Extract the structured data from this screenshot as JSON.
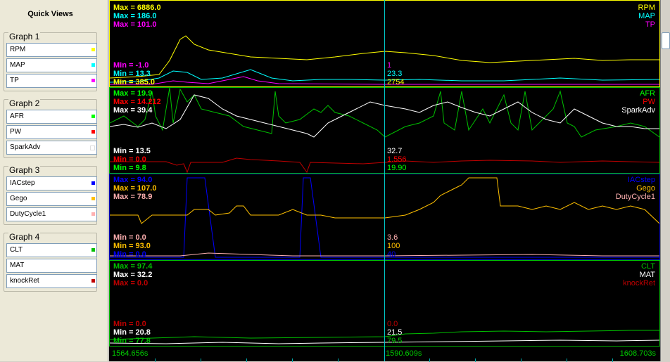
{
  "sidebar": {
    "title": "Quick Views",
    "groups": [
      {
        "title": "Graph 1",
        "items": [
          {
            "label": "RPM",
            "color": "#ffff00"
          },
          {
            "label": "MAP",
            "color": "#00ffff"
          },
          {
            "label": "TP",
            "color": "#ff00ff"
          }
        ]
      },
      {
        "title": "Graph 2",
        "items": [
          {
            "label": "AFR",
            "color": "#00ff00"
          },
          {
            "label": "PW",
            "color": "#ff0000"
          },
          {
            "label": "SparkAdv",
            "color": "#ffffff"
          }
        ]
      },
      {
        "title": "Graph 3",
        "items": [
          {
            "label": "IACstep",
            "color": "#0000ff"
          },
          {
            "label": "Gego",
            "color": "#ffc000"
          },
          {
            "label": "DutyCycle1",
            "color": "#ffb0b0"
          }
        ]
      },
      {
        "title": "Graph 4",
        "items": [
          {
            "label": "CLT",
            "color": "#00c000"
          },
          {
            "label": "MAT",
            "color": ""
          },
          {
            "label": "knockRet",
            "color": "#c00000"
          }
        ]
      }
    ]
  },
  "graphs": [
    {
      "max": [
        {
          "label": "Max = 6886.0",
          "color": "#ffff00"
        },
        {
          "label": "Max = 186.0",
          "color": "#00ffff"
        },
        {
          "label": "Max = 101.0",
          "color": "#ff00ff"
        }
      ],
      "min": [
        {
          "label": "Min = -1.0",
          "color": "#ff00ff"
        },
        {
          "label": "Min = 13.3",
          "color": "#00ffff"
        },
        {
          "label": "Min = 385.0",
          "color": "#ffff00"
        }
      ],
      "cursor": [
        {
          "value": "1",
          "color": "#ff00ff"
        },
        {
          "value": "23.3",
          "color": "#00ffff"
        },
        {
          "value": "2754",
          "color": "#ffff00"
        }
      ],
      "names": [
        {
          "label": "RPM",
          "color": "#ffff00"
        },
        {
          "label": "MAP",
          "color": "#00ffff"
        },
        {
          "label": "TP",
          "color": "#ff00ff"
        }
      ]
    },
    {
      "max": [
        {
          "label": "Max = 19.9",
          "color": "#00ff00"
        },
        {
          "label": "Max = 14.212",
          "color": "#ff0000"
        },
        {
          "label": "Max = 39.4",
          "color": "#ffffff"
        }
      ],
      "min": [
        {
          "label": "Min = 13.5",
          "color": "#ffffff"
        },
        {
          "label": "Min = 0.0",
          "color": "#ff0000"
        },
        {
          "label": "Min = 9.8",
          "color": "#00ff00"
        }
      ],
      "cursor": [
        {
          "value": "32.7",
          "color": "#ffffff"
        },
        {
          "value": "1.556",
          "color": "#ff0000"
        },
        {
          "value": "19.90",
          "color": "#00ff00"
        }
      ],
      "names": [
        {
          "label": "AFR",
          "color": "#00ff00"
        },
        {
          "label": "PW",
          "color": "#ff0000"
        },
        {
          "label": "SparkAdv",
          "color": "#ffffff"
        }
      ]
    },
    {
      "max": [
        {
          "label": "Max = 94.0",
          "color": "#0000ff"
        },
        {
          "label": "Max = 107.0",
          "color": "#ffc000"
        },
        {
          "label": "Max = 78.9",
          "color": "#ffb0b0"
        }
      ],
      "min": [
        {
          "label": "Min = 0.0",
          "color": "#ffb0b0"
        },
        {
          "label": "Min = 93.0",
          "color": "#ffc000"
        },
        {
          "label": "Min = 0.0",
          "color": "#0000ff"
        }
      ],
      "cursor": [
        {
          "value": "3.6",
          "color": "#ffb0b0"
        },
        {
          "value": "100",
          "color": "#ffc000"
        },
        {
          "value": "40",
          "color": "#0000ff"
        }
      ],
      "names": [
        {
          "label": "IACstep",
          "color": "#0000ff"
        },
        {
          "label": "Gego",
          "color": "#ffc000"
        },
        {
          "label": "DutyCycle1",
          "color": "#ffb0b0"
        }
      ]
    },
    {
      "max": [
        {
          "label": "Max = 97.4",
          "color": "#00c000"
        },
        {
          "label": "Max = 32.2",
          "color": "#ffffff"
        },
        {
          "label": "Max = 0.0",
          "color": "#c00000"
        }
      ],
      "min": [
        {
          "label": "Min = 0.0",
          "color": "#c00000"
        },
        {
          "label": "Min = 20.8",
          "color": "#ffffff"
        },
        {
          "label": "Min = 77.8",
          "color": "#00c000"
        }
      ],
      "cursor": [
        {
          "value": "0.0",
          "color": "#c00000"
        },
        {
          "value": "21.5",
          "color": "#ffffff"
        },
        {
          "value": "79.5",
          "color": "#00c000"
        }
      ],
      "names": [
        {
          "label": "CLT",
          "color": "#00c000"
        },
        {
          "label": "MAT",
          "color": "#ffffff"
        },
        {
          "label": "knockRet",
          "color": "#c00000"
        }
      ]
    }
  ],
  "time_axis": {
    "start": "1564.656s",
    "cursor": "1590.609s",
    "end": "1608.703s"
  }
}
